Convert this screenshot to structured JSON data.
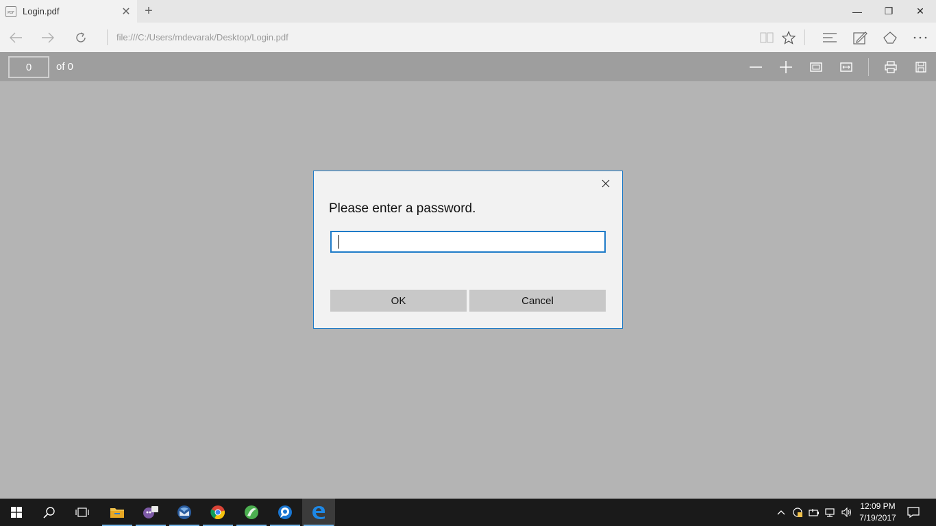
{
  "browser": {
    "tab": {
      "title": "Login.pdf",
      "icon": "pdf-file-icon",
      "close_glyph": "✕"
    },
    "new_tab_glyph": "+",
    "window_controls": {
      "minimize": "—",
      "restore": "❐",
      "close": "✕"
    },
    "address": "file:///C:/Users/mdevarak/Desktop/Login.pdf",
    "nav_icons": [
      "back-arrow-icon",
      "forward-arrow-icon",
      "refresh-icon"
    ],
    "toolbar_icons": [
      "reading-view-icon",
      "favorite-star-icon",
      "hub-icon",
      "web-note-icon",
      "share-icon",
      "more-icon"
    ]
  },
  "pdf_toolbar": {
    "page_current": "0",
    "page_total_text": "of 0",
    "tools": [
      "zoom-out-icon",
      "zoom-in-icon",
      "fit-page-icon",
      "fit-width-icon",
      "print-icon",
      "save-icon"
    ]
  },
  "dialog": {
    "title": "Please enter a password.",
    "password_value": "",
    "ok_label": "OK",
    "cancel_label": "Cancel",
    "accent_color": "#1e7bc8"
  },
  "taskbar": {
    "apps": [
      "file-explorer-icon",
      "chat-app-icon",
      "thunderbird-icon",
      "chrome-icon",
      "green-app-icon",
      "messenger-icon",
      "edge-icon"
    ],
    "active_app": "edge-icon",
    "clock_time": "12:09 PM",
    "clock_date": "7/19/2017"
  }
}
